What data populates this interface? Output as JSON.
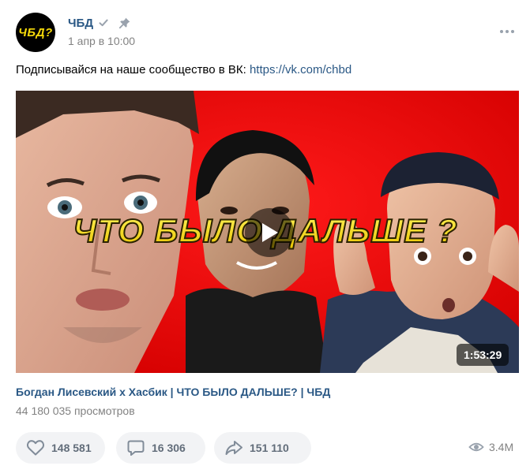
{
  "post": {
    "avatar_text": "ЧБД?",
    "author": "ЧБД",
    "date": "1 апр в 10:00",
    "text_prefix": "Подписывайся на наше сообщество в ВК: ",
    "link": "https://vk.com/chbd"
  },
  "video": {
    "overlay_title": "ЧТО БЫЛО ДАЛЬШЕ ?",
    "duration": "1:53:29",
    "title": "Богдан Лисевский х Хасбик | ЧТО БЫЛО ДАЛЬШЕ? | ЧБД",
    "views": "44 180 035 просмотров"
  },
  "actions": {
    "likes": "148 581",
    "comments": "16 306",
    "shares": "151 110",
    "views": "3.4M"
  },
  "icons": {
    "verified": "verified-check-icon",
    "pin": "pin-icon",
    "more": "more-dots-icon",
    "play": "play-icon",
    "like": "heart-icon",
    "comment": "comment-icon",
    "share": "share-arrow-icon",
    "views": "eye-icon"
  },
  "colors": {
    "link": "#2a5885",
    "muted": "#828282",
    "thumbnail_red": "#e3000b",
    "overlay_yellow": "#f2e203",
    "action_bg": "#f2f3f5"
  }
}
